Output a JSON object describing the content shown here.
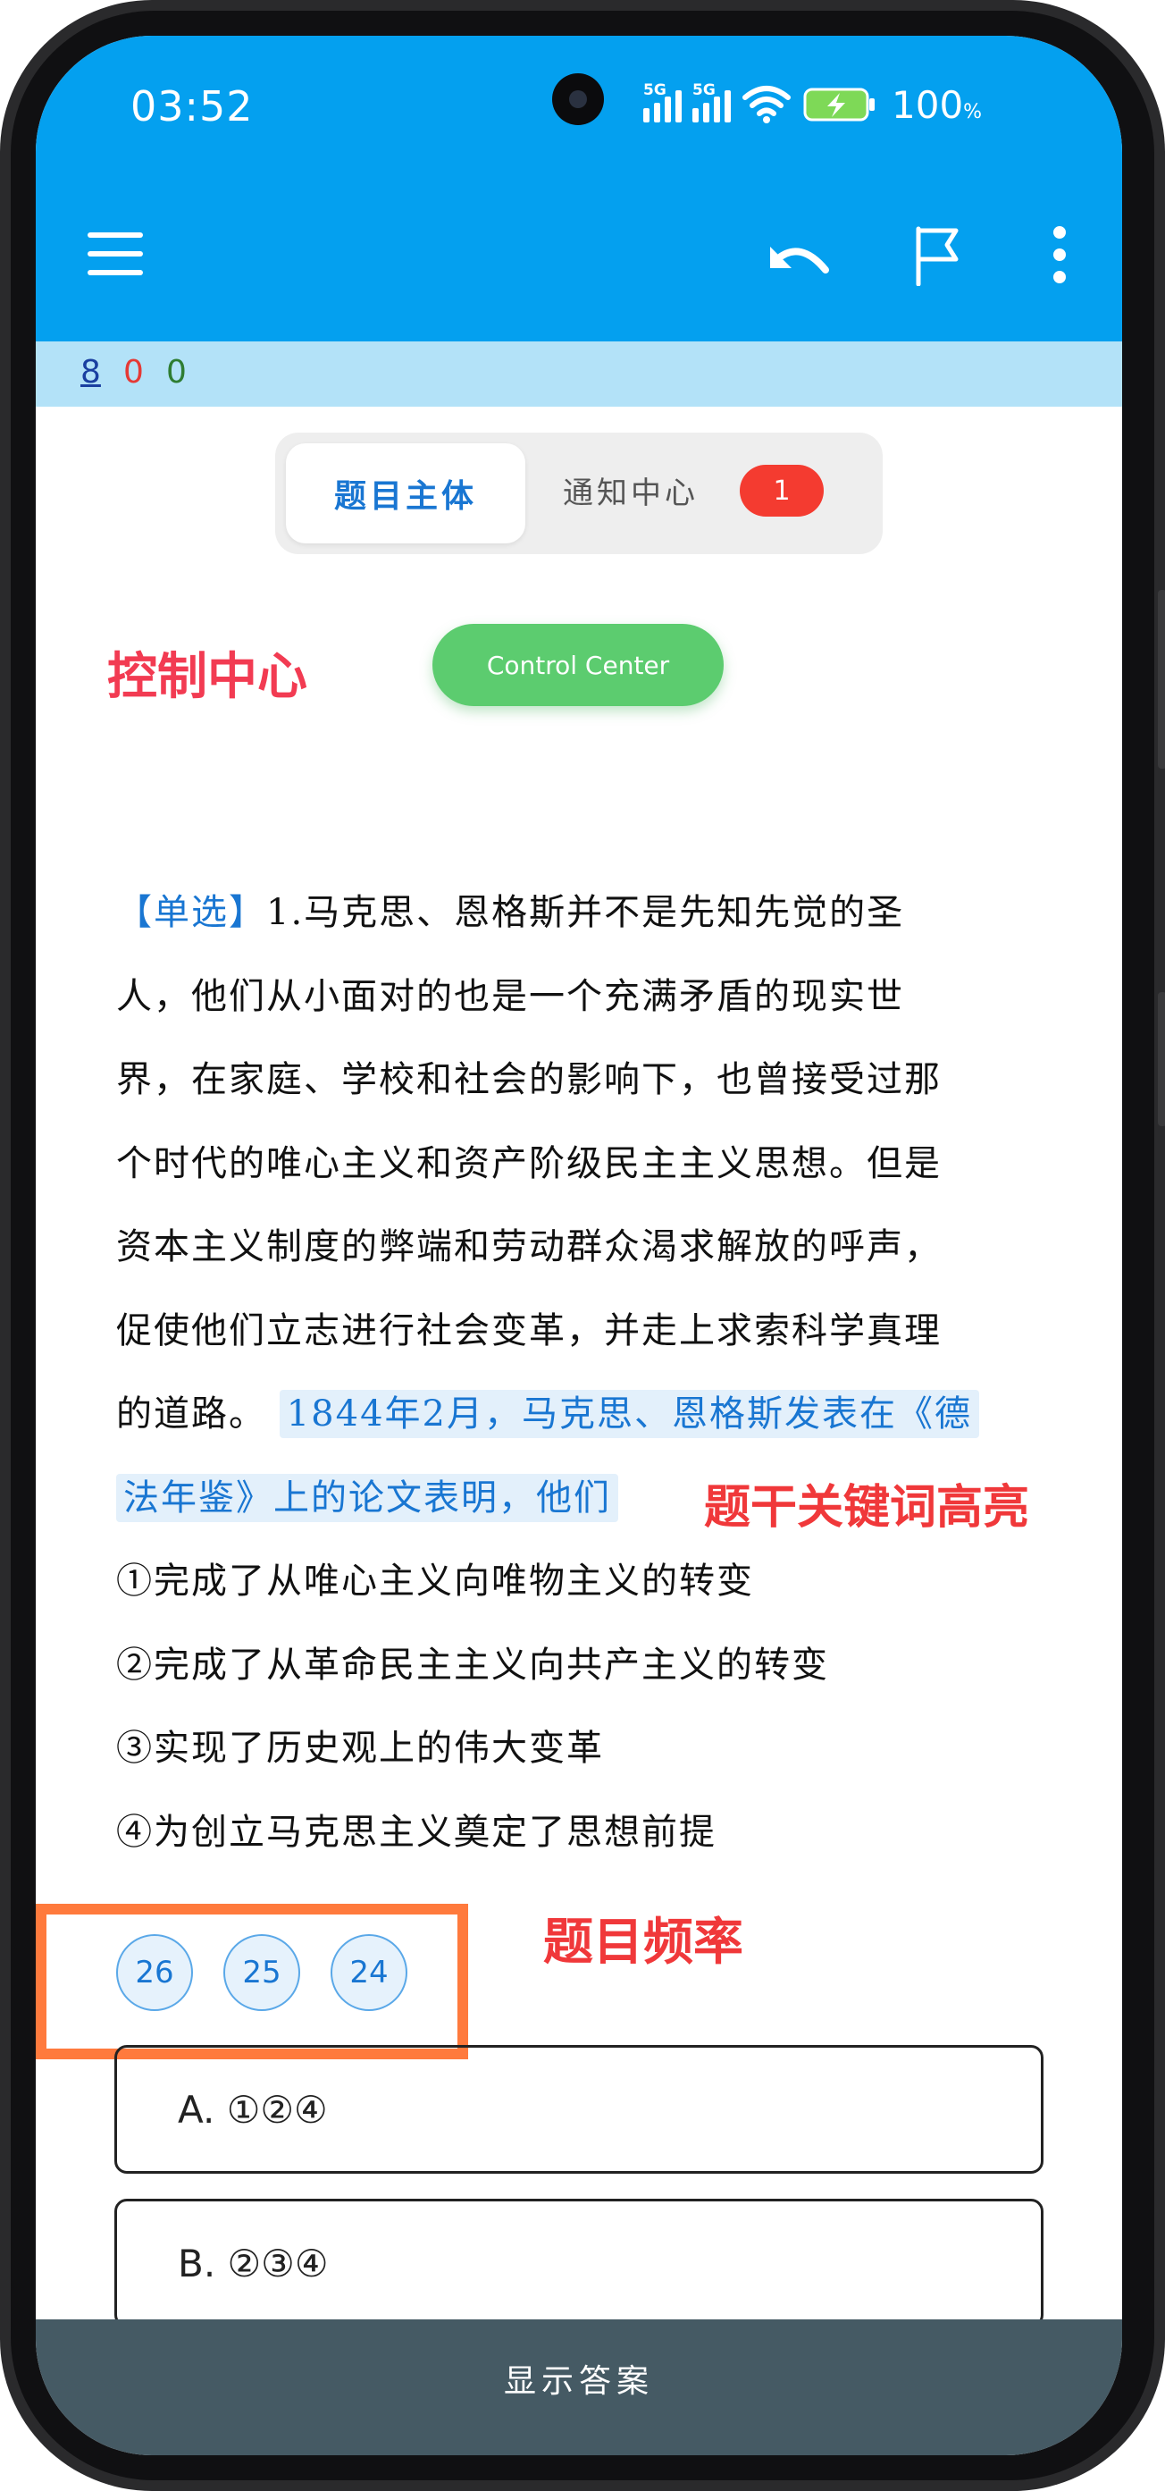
{
  "status_bar": {
    "time": "03:52",
    "network_1": "5G",
    "network_2": "5G",
    "battery": "100",
    "battery_unit": "%"
  },
  "toolbar": {
    "icons": [
      "menu-icon",
      "undo-icon",
      "flag-icon",
      "more-vertical-icon"
    ]
  },
  "score": {
    "first": "8",
    "second": "0",
    "third": "0",
    "colors": {
      "first": "#1a3fa0",
      "second": "#e53935",
      "third": "#2e7d32"
    }
  },
  "tabs": {
    "active": "题目主体",
    "inactive": "通知中心",
    "badge": "1"
  },
  "annotations": {
    "control": "控制中心",
    "keywords": "题干关键词高亮",
    "frequency": "题目频率"
  },
  "control_center_button": "Control Center",
  "question": {
    "type": "【单选】",
    "line1": "1.马克思、恩格斯并不是先知先觉的圣",
    "line2": "人，他们从小面对的也是一个充满矛盾的现实世",
    "line3": "界，在家庭、学校和社会的影响下，也曾接受过那",
    "line4": "个时代的唯心主义和资产阶级民主主义思想。但是",
    "line5": "资本主义制度的弊端和劳动群众渴求解放的呼声，",
    "line6": "促使他们立志进行社会变革，并走上求索科学真理",
    "line7_plain": "的道路。",
    "highlight_1": "1844年2月，马克思、恩格斯发表在《德",
    "highlight_2": "法年鉴》上的论文表明，他们",
    "statements": [
      "①完成了从唯心主义向唯物主义的转变",
      "②完成了从革命民主主义向共产主义的转变",
      "③实现了历史观上的伟大变革",
      "④为创立马克思主义奠定了思想前提"
    ]
  },
  "frequency": [
    "26",
    "25",
    "24"
  ],
  "options": [
    "A. ①②④",
    "B. ②③④"
  ],
  "bottom_button": "显示答案",
  "colors": {
    "header": "#04a0ef",
    "score_strip": "#b3e2f8",
    "accent_blue": "#1976d2",
    "control_button": "#5ccc6f",
    "badge": "#f43b30",
    "frequency_box": "#ff7a3d",
    "bottom_bar": "#455a64"
  }
}
